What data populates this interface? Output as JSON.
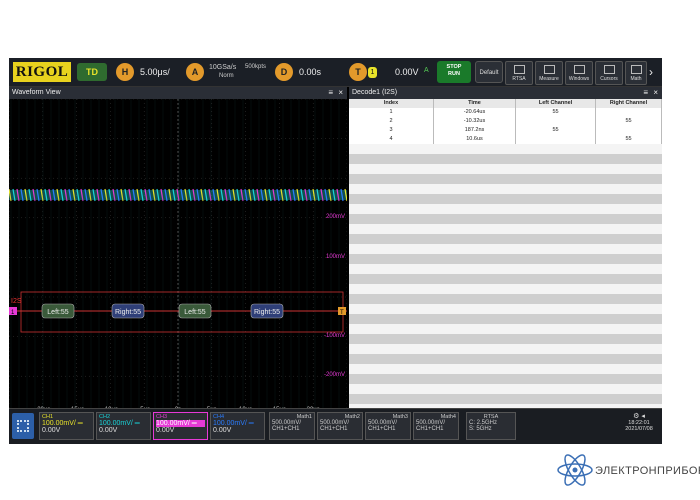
{
  "topbar": {
    "logo": "RIGOL",
    "mode": "TD",
    "h_letter": "H",
    "timebase": "5.00μs/",
    "a_letter": "A",
    "sample_rate": "10GSa/s",
    "acq_mode": "Norm",
    "mem_depth": "500kpts",
    "d_letter": "D",
    "delay": "0.00s",
    "t_letter": "T",
    "trig_source": "1",
    "trig_level": "0.00V",
    "trig_coupling": "A",
    "stop_run": "STOP\nRUN",
    "default_label": "Default",
    "tools": [
      "RTSA",
      "Measure",
      "Windows",
      "Cursors",
      "Math"
    ],
    "next": "›"
  },
  "waveform": {
    "title": "Waveform View",
    "bus_label": "I2S",
    "y_labels": [
      "200mV",
      "100mV",
      "-100mV",
      "-200mV"
    ],
    "x_labels": [
      "-20μs",
      "-15μs",
      "-10μs",
      "-5μs",
      "0s",
      "5μs",
      "10μs",
      "15μs",
      "20μs"
    ],
    "packets": [
      "Left:55",
      "Right:55",
      "Left:55",
      "Right:55"
    ],
    "ch_marker": "1",
    "trig_marker": "T"
  },
  "decode": {
    "title": "Decode1 (I2S)",
    "columns": [
      "Index",
      "Time",
      "Left Channel",
      "Right Channel"
    ],
    "rows": [
      [
        "1",
        "-20.64us",
        "55",
        ""
      ],
      [
        "2",
        "-10.32us",
        "",
        "55"
      ],
      [
        "3",
        "187.2ns",
        "55",
        ""
      ],
      [
        "4",
        "10.6us",
        "",
        "55"
      ]
    ]
  },
  "channels": [
    {
      "name": "CH1",
      "scale": "100.00mV/",
      "offset": "0.00V",
      "color": "#e8e32a"
    },
    {
      "name": "CH2",
      "scale": "100.00mV/",
      "offset": "0.00V",
      "color": "#19d3d8"
    },
    {
      "name": "CH3",
      "scale": "100.00mV/",
      "offset": "0.00V",
      "color": "#e63ad6"
    },
    {
      "name": "CH4",
      "scale": "100.00mV/",
      "offset": "0.00V",
      "color": "#2a7cff"
    }
  ],
  "maths": [
    {
      "name": "Math1",
      "scale": "500.00mV/",
      "src": "CH1+CH1"
    },
    {
      "name": "Math2",
      "scale": "500.00mV/",
      "src": "CH1+CH1"
    },
    {
      "name": "Math3",
      "scale": "500.00mV/",
      "src": "CH1+CH1"
    },
    {
      "name": "Math4",
      "scale": "500.00mV/",
      "src": "CH1+CH1"
    }
  ],
  "rtsa": {
    "name": "RTSA",
    "center": "C: 2.5GHz",
    "span": "S: 5GHz"
  },
  "status": {
    "time": "18:22:01",
    "date": "2021/07/08"
  },
  "footer": {
    "brand": "ЭЛЕКТРОНПРИБОР"
  }
}
